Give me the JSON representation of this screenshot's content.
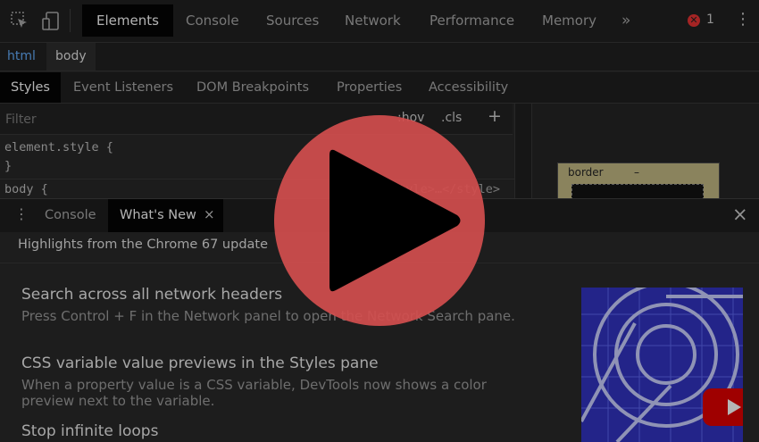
{
  "topbar": {
    "tabs": [
      "Elements",
      "Console",
      "Sources",
      "Network",
      "Performance",
      "Memory"
    ],
    "active_tab": "Elements",
    "more_tabs": "»",
    "error_count": "1",
    "menu": "⋮"
  },
  "breadcrumbs": [
    "html",
    "body"
  ],
  "styles": {
    "subtabs": [
      "Styles",
      "Event Listeners",
      "DOM Breakpoints",
      "Properties",
      "Accessibility"
    ],
    "filter_placeholder": "Filter",
    "hov": ":hov",
    "cls": ".cls",
    "add": "+",
    "rules": [
      {
        "selector": "element.style {",
        "close": "}"
      },
      {
        "selector": "body {",
        "source": "<style>…</style>"
      }
    ],
    "box_label": "border",
    "box_dash": "–"
  },
  "drawer": {
    "tabs": [
      "Console",
      "What's New"
    ],
    "active_tab": "What's New",
    "close_tab": "×",
    "close_drawer": "×"
  },
  "whats_new": {
    "title": "Highlights from the Chrome 67 update",
    "items": [
      {
        "title": "Search across all network headers",
        "desc": "Press Control + F in the Network panel to open the Network Search pane."
      },
      {
        "title": "CSS variable value previews in the Styles pane",
        "desc": "When a property value is a CSS variable, DevTools now shows a color preview next to the variable."
      },
      {
        "title": "Stop infinite loops",
        "desc": ""
      }
    ]
  },
  "colors": {
    "play_button": "#d34e4e",
    "youtube_red": "#cc0000",
    "active_tab_bg": "#050505",
    "thumbnail_bg": "#2d2fb0"
  }
}
